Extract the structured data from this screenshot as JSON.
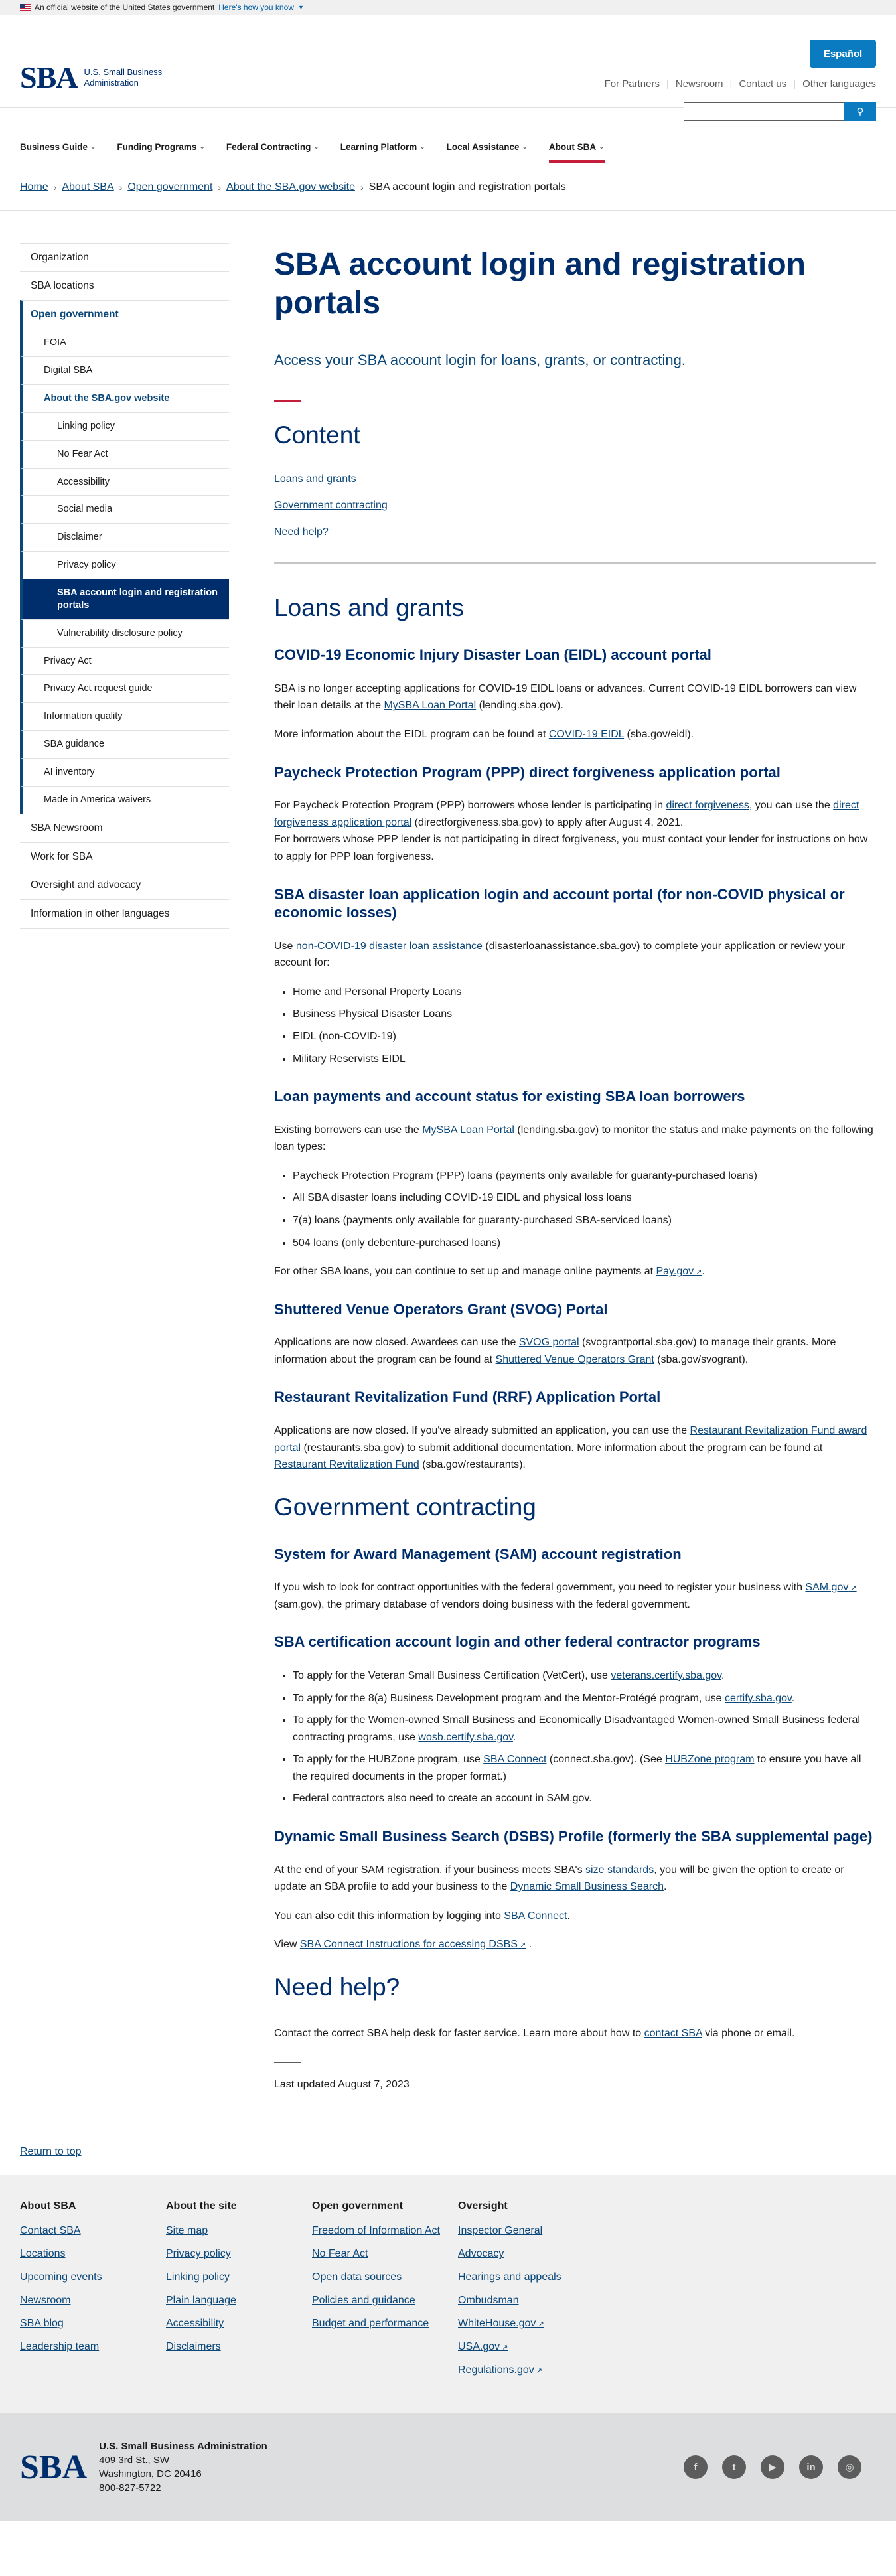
{
  "banner": {
    "text": "An official website of the United States government",
    "link": "Here's how you know"
  },
  "header": {
    "logo_mark": "SBA",
    "logo_line1": "U.S. Small Business",
    "logo_line2": "Administration",
    "espanol": "Español",
    "util_links": [
      "For Partners",
      "Newsroom",
      "Contact us",
      "Other languages"
    ]
  },
  "nav": [
    "Business Guide",
    "Funding Programs",
    "Federal Contracting",
    "Learning Platform",
    "Local Assistance",
    "About SBA"
  ],
  "breadcrumb": [
    "Home",
    "About SBA",
    "Open government",
    "About the SBA.gov website",
    "SBA account login and registration portals"
  ],
  "sidenav": {
    "top": [
      "Organization",
      "SBA locations",
      "Open government"
    ],
    "og_children": [
      "FOIA",
      "Digital SBA",
      "About the SBA.gov website"
    ],
    "web_children": [
      "Linking policy",
      "No Fear Act",
      "Accessibility",
      "Social media",
      "Disclaimer",
      "Privacy policy",
      "SBA account login and registration portals",
      "Vulnerability disclosure policy"
    ],
    "og_children_after": [
      "Privacy Act",
      "Privacy Act request guide",
      "Information quality",
      "SBA guidance",
      "AI inventory",
      "Made in America waivers"
    ],
    "bottom": [
      "SBA Newsroom",
      "Work for SBA",
      "Oversight and advocacy",
      "Information in other languages"
    ]
  },
  "main": {
    "title": "SBA account login and registration portals",
    "intro": "Access your SBA account login for loans, grants, or contracting.",
    "content_heading": "Content",
    "toc": [
      "Loans and grants",
      "Government contracting",
      "Need help?"
    ],
    "loans_heading": "Loans and grants",
    "eidl": {
      "h": "COVID-19 Economic Injury Disaster Loan (EIDL) account portal",
      "p1a": "SBA is no longer accepting applications for COVID-19 EIDL loans or advances. Current COVID-19 EIDL borrowers can view their loan details at the ",
      "p1link": "MySBA Loan Portal",
      "p1b": " (lending.sba.gov).",
      "p2a": "More information about the EIDL program can be found at ",
      "p2link": "COVID-19 EIDL",
      "p2b": " (sba.gov/eidl)."
    },
    "ppp": {
      "h": "Paycheck Protection Program (PPP) direct forgiveness application portal",
      "p1a": "For Paycheck Protection Program (PPP) borrowers whose lender is participating in ",
      "p1link1": "direct forgiveness",
      "p1b": ", you can use the ",
      "p1link2": "direct forgiveness application portal",
      "p1c": " (directforgiveness.sba.gov) to apply after August 4, 2021.",
      "p2": "For borrowers whose PPP lender is not participating in direct forgiveness, you must contact your lender for instructions on how to apply for PPP loan forgiveness."
    },
    "disaster": {
      "h": "SBA disaster loan application login and account portal (for non-COVID physical or economic losses)",
      "p1a": "Use ",
      "p1link": "non-COVID-19 disaster loan assistance",
      "p1b": " (disasterloanassistance.sba.gov) to complete your application or review your account for:",
      "items": [
        "Home and Personal Property Loans",
        "Business Physical Disaster Loans",
        "EIDL (non-COVID-19)",
        "Military Reservists EIDL"
      ]
    },
    "payments": {
      "h": "Loan payments and account status for existing SBA loan borrowers",
      "p1a": "Existing borrowers can use the ",
      "p1link": "MySBA Loan Portal",
      "p1b": " (lending.sba.gov) to monitor the status and make payments on the following loan types:",
      "items": [
        "Paycheck Protection Program (PPP) loans (payments only available for guaranty-purchased loans)",
        "All SBA disaster loans including COVID-19 EIDL and physical loss loans",
        "7(a) loans (payments only available for guaranty-purchased SBA-serviced loans)",
        "504 loans (only debenture-purchased loans)"
      ],
      "p2a": "For other SBA loans, you can continue to set up and manage online payments at ",
      "p2link": "Pay.gov",
      "p2b": "."
    },
    "svog": {
      "h": "Shuttered Venue Operators Grant (SVOG) Portal",
      "pa": "Applications are now closed. Awardees can use the ",
      "plink1": "SVOG portal",
      "pb": " (svograntportal.sba.gov) to manage their grants. More information about the program can be found at ",
      "plink2": "Shuttered Venue Operators Grant",
      "pc": " (sba.gov/svogrant)."
    },
    "rrf": {
      "h": "Restaurant Revitalization Fund (RRF) Application Portal",
      "pa": "Applications are now closed. If you've already submitted an application, you can use the ",
      "plink1": "Restaurant Revitalization Fund award portal",
      "pb": " (restaurants.sba.gov) to submit additional documentation. More information about  the program can be found at ",
      "plink2": "Restaurant Revitalization Fund",
      "pc": " (sba.gov/restaurants)."
    },
    "gov_heading": "Government contracting",
    "sam": {
      "h": "System for Award Management (SAM) account registration",
      "pa": "If you wish to look for contract opportunities with the federal government, you need to register your business with ",
      "plink": "SAM.gov",
      "pb": " (sam.gov), the primary database of vendors doing business with the federal government."
    },
    "cert": {
      "h": "SBA certification account login and other federal contractor programs",
      "i1a": "To apply for the Veteran Small Business Certification (VetCert), use ",
      "i1link": "veterans.certify.sba.gov",
      "i1b": ".",
      "i2a": "To apply for the 8(a) Business Development program and the Mentor-Protégé program, use ",
      "i2link": "certify.sba.gov",
      "i2b": ".",
      "i3a": "To apply for the Women-owned Small Business and Economically Disadvantaged Women-owned Small Business federal contracting programs, use ",
      "i3link": "wosb.certify.sba.gov",
      "i3b": ".",
      "i4a": "To apply for the HUBZone program, use ",
      "i4link1": "SBA Connect",
      "i4b": " (connect.sba.gov).  (See ",
      "i4link2": "HUBZone program",
      "i4c": " to ensure you have all the required documents in the proper format.)",
      "i5": "Federal contractors also need to create an account in SAM.gov."
    },
    "dsbs": {
      "h": "Dynamic Small Business Search (DSBS) Profile (formerly the SBA supplemental page)",
      "p1a": "At the end of your SAM registration, if your business meets SBA's ",
      "p1link1": "size standards",
      "p1b": ", you will be given the option to create or update an SBA profile to add your business to the ",
      "p1link2": "Dynamic Small Business Search",
      "p1c": ".",
      "p2a": "You can also edit this information by logging into ",
      "p2link": "SBA Connect",
      "p2b": ".",
      "p3a": "View ",
      "p3link": "SBA Connect Instructions for accessing DSBS",
      "p3b": " ."
    },
    "help_heading": "Need help?",
    "help": {
      "pa": "Contact the correct SBA help desk for faster service. Learn more about how to ",
      "plink": "contact SBA",
      "pb": " via phone or email."
    },
    "updated": "Last updated August 7, 2023"
  },
  "return_top": "Return to top",
  "footer": {
    "cols": [
      {
        "h": "About SBA",
        "links": [
          "Contact SBA",
          "Locations",
          "Upcoming events",
          "Newsroom",
          "SBA blog",
          "Leadership team"
        ]
      },
      {
        "h": "About the site",
        "links": [
          "Site map",
          "Privacy policy",
          "Linking policy",
          "Plain language",
          "Accessibility",
          "Disclaimers"
        ]
      },
      {
        "h": "Open government",
        "links": [
          "Freedom of Information Act",
          "No Fear Act",
          "Open data sources",
          "Policies and guidance",
          "Budget and performance"
        ]
      },
      {
        "h": "Oversight",
        "links": [
          "Inspector General",
          "Advocacy",
          "Hearings and appeals",
          "Ombudsman",
          "WhiteHouse.gov",
          "USA.gov",
          "Regulations.gov"
        ]
      }
    ],
    "agency": "U.S. Small Business Administration",
    "address1": "409 3rd St., SW",
    "address2": "Washington, DC 20416",
    "phone": "800-827-5722",
    "social": [
      "f",
      "t",
      "▶",
      "in",
      "◎"
    ]
  },
  "colors": {
    "navy": "#002e6d",
    "link": "#0b4778",
    "accent_red": "#c41e3a",
    "button_blue": "#0b7bc1"
  }
}
